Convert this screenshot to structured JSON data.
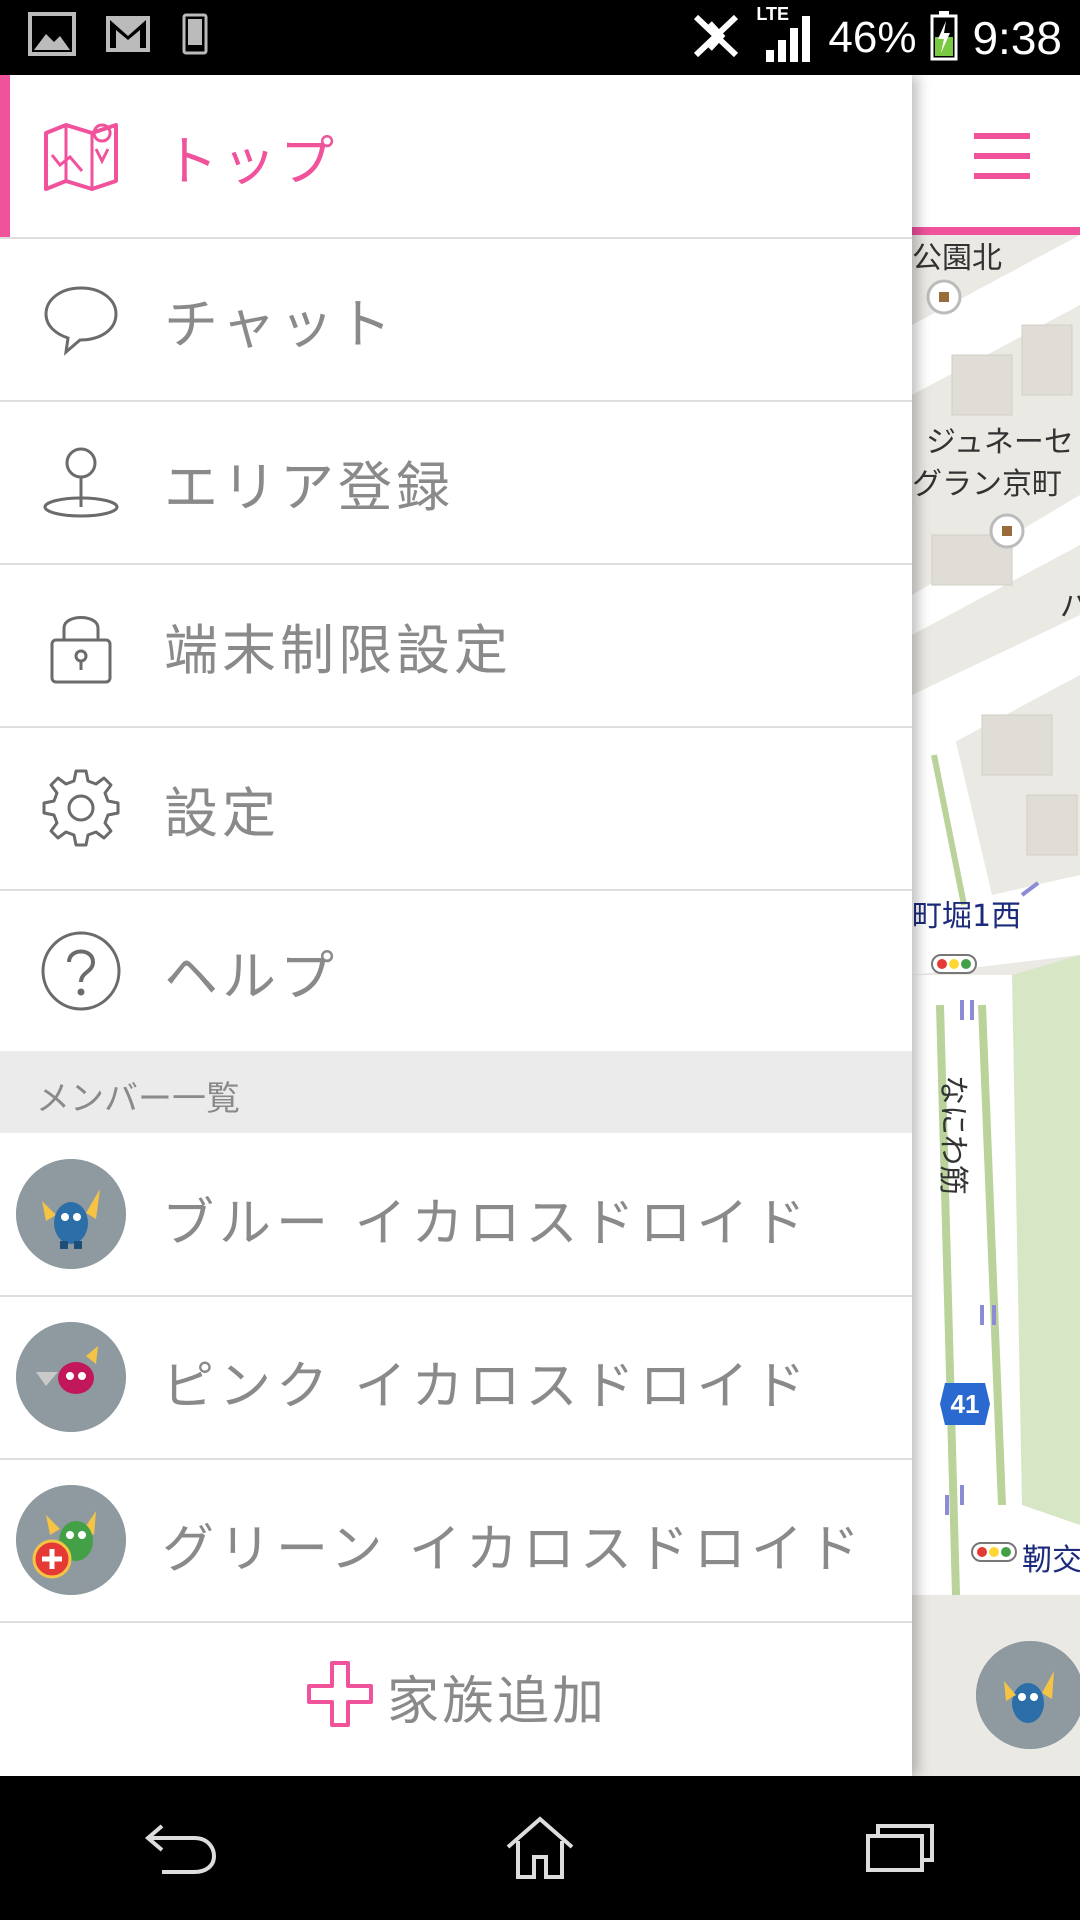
{
  "status_bar": {
    "icons_left": [
      "image-icon",
      "gmail-icon",
      "phone-icon"
    ],
    "network": "LTE",
    "battery": "46%",
    "time": "9:38"
  },
  "drawer": {
    "menu": [
      {
        "label": "トップ",
        "icon": "map-icon",
        "active": true
      },
      {
        "label": "チャット",
        "icon": "chat-bubble-icon",
        "active": false
      },
      {
        "label": "エリア登録",
        "icon": "map-pin-icon",
        "active": false
      },
      {
        "label": "端末制限設定",
        "icon": "lock-icon",
        "active": false
      },
      {
        "label": "設定",
        "icon": "gear-icon",
        "active": false
      },
      {
        "label": "ヘルプ",
        "icon": "help-icon",
        "active": false
      }
    ],
    "members_header": "メンバー一覧",
    "members": [
      {
        "name": "ブルー イカロスドロイド",
        "color": "#3a7bd5"
      },
      {
        "name": "ピンク イカロスドロイド",
        "color": "#c2185b"
      },
      {
        "name": "グリーン イカロスドロイド",
        "color": "#43a047"
      }
    ],
    "add_family_label": "家族追加"
  },
  "map": {
    "labels": {
      "park_north": "公園北",
      "building_1": "ジュネーセ",
      "building_2": "グラン京町",
      "building_3": "パ",
      "intersection": "町堀1西",
      "street": "なにわ筋",
      "route_number": "41",
      "intersection_2": "靭交"
    }
  },
  "colors": {
    "accent": "#f0529c",
    "text_gray": "#8a8a8a",
    "divider": "#dedede",
    "section_bg": "#ebebeb"
  }
}
